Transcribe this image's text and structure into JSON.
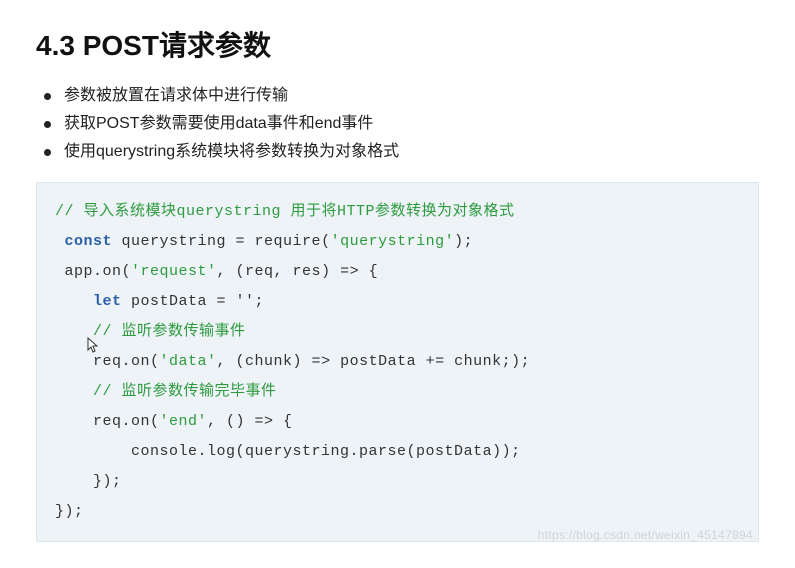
{
  "heading": "4.3 POST请求参数",
  "bullets": [
    "参数被放置在请求体中进行传输",
    "获取POST参数需要使用data事件和end事件",
    "使用querystring系统模块将参数转换为对象格式"
  ],
  "code": {
    "l1_comment": "// 导入系统模块querystring 用于将HTTP参数转换为对象格式",
    "l2_kw": "const",
    "l2_rest1": " querystring = require(",
    "l2_str": "'querystring'",
    "l2_rest2": ");",
    "l3_a": "app.on(",
    "l3_str": "'request'",
    "l3_b": ", (req, res) => {",
    "l4_indent": "    ",
    "l4_kw": "let",
    "l4_rest": " postData = '';",
    "l5_indent": "    ",
    "l5_comment": "// 监听参数传输事件",
    "l6": "    req.on(",
    "l6_str": "'data'",
    "l6_b": ", (chunk) => postData += chunk;);",
    "l7_indent": "    ",
    "l7_comment": "// 监听参数传输完毕事件",
    "l8": "    req.on(",
    "l8_str": "'end'",
    "l8_b": ", () => {",
    "l9": "        console.log(querystring.parse(postData));",
    "l10": "    });",
    "l11": "});"
  },
  "watermark": "https://blog.csdn.net/weixin_45147894"
}
